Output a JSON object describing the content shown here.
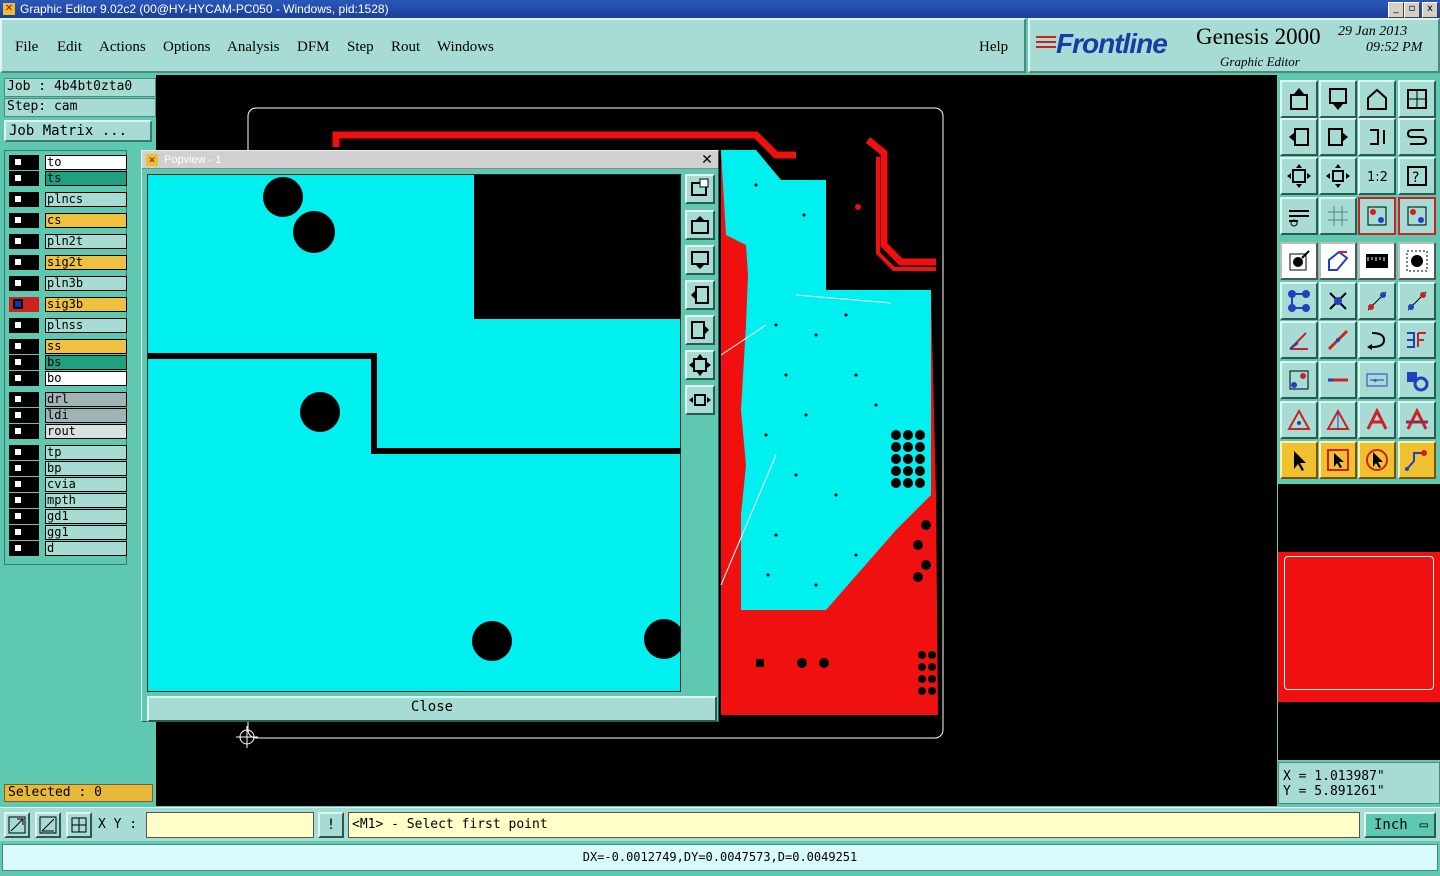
{
  "window": {
    "title": "Graphic Editor 9.02c2 (00@HY-HYCAM-PC050 - Windows, pid:1528)",
    "buttons": [
      "_",
      "▫",
      "x"
    ]
  },
  "menu": [
    "File",
    "Edit",
    "Actions",
    "Options",
    "Analysis",
    "DFM",
    "Step",
    "Rout",
    "Windows"
  ],
  "help_label": "Help",
  "brand": {
    "logo": "Frontline",
    "app": "Genesis 2000",
    "subtitle": "Graphic Editor",
    "date": "29 Jan 2013",
    "time": "09:52 PM"
  },
  "job": {
    "job_line": "Job : 4b4bt0zta0",
    "step_line": "Step: cam",
    "matrix_button": "Job Matrix ..."
  },
  "layers": [
    {
      "name": "to",
      "color": "#ffffff"
    },
    {
      "name": "ts",
      "color": "#20a080"
    },
    {
      "name": "plncs",
      "color": "#a6dcd4"
    },
    {
      "name": "cs",
      "color": "#f0c040"
    },
    {
      "name": "pln2t",
      "color": "#a6dcd4"
    },
    {
      "name": "sig2t",
      "color": "#f0c040"
    },
    {
      "name": "pln3b",
      "color": "#a6dcd4"
    },
    {
      "name": "sig3b",
      "color": "#f0c040"
    },
    {
      "name": "plnss",
      "color": "#a6dcd4"
    },
    {
      "name": "ss",
      "color": "#f0c040"
    },
    {
      "name": "bs",
      "color": "#20a080"
    },
    {
      "name": "bo",
      "color": "#ffffff"
    },
    {
      "name": "drl",
      "color": "#a0b4b8"
    },
    {
      "name": "ldi",
      "color": "#a0b4b8"
    },
    {
      "name": "rout",
      "color": "#d8e0e0"
    },
    {
      "name": "tp",
      "color": "#a6dcd4"
    },
    {
      "name": "bp",
      "color": "#a6dcd4"
    },
    {
      "name": "cvia",
      "color": "#a6dcd4"
    },
    {
      "name": "mpth",
      "color": "#a6dcd4"
    },
    {
      "name": "gd1",
      "color": "#a6dcd4"
    },
    {
      "name": "gg1",
      "color": "#a6dcd4"
    },
    {
      "name": "d",
      "color": "#a6dcd4"
    }
  ],
  "selected": "Selected : 0",
  "popview": {
    "title": "Popview - 1",
    "close_label": "Close",
    "close_x": "✕"
  },
  "coords": {
    "x": "X =  1.013987\"",
    "y": "Y =  5.891261\""
  },
  "cmd": {
    "xy_label": "X Y :",
    "warn": "!",
    "prompt": "<M1> - Select first point",
    "unit": "Inch"
  },
  "status": "DX=-0.0012749,DY=0.0047573,D=0.0049251",
  "toolbar_icons": [
    "zoom-home-icon",
    "zoom-out-icon",
    "home-icon",
    "window-icon",
    "pan-left-icon",
    "pan-right-icon",
    "flip-icon",
    "s-curve-icon",
    "fit-all-icon",
    "fit-profile-icon",
    "ratio-1-2-icon",
    "help-icon",
    "measure-icon",
    "grid-icon",
    "layer-comp-icon",
    "layer-comp-active-icon",
    "snap-arrow-icon",
    "select-shape-icon",
    "ruler-icon",
    "pad-icon",
    "connect-icon",
    "x-node-icon",
    "line-node-icon",
    "line-arrow-icon",
    "angle-icon",
    "diagonal-line-icon",
    "arc-icon",
    "text-f-icon",
    "pad-add-icon",
    "line-red-icon",
    "bbox-icon",
    "shapes-icon",
    "triangle-icon",
    "triangle-a-icon",
    "a-shape-icon",
    "a-line-icon",
    "pointer-icon",
    "pointer-box-icon",
    "pointer-circle-icon",
    "route-icon"
  ]
}
